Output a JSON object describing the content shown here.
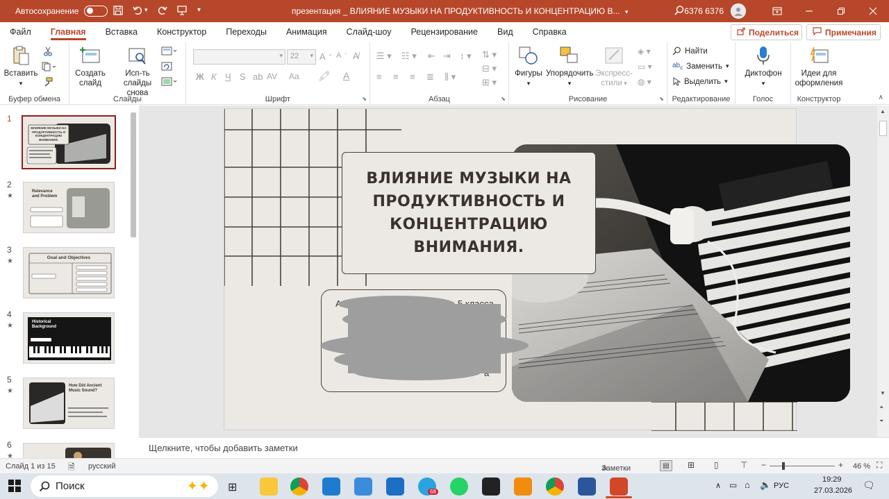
{
  "title_bar": {
    "autosave_label": "Автосохранение",
    "document_title": "презентация _ ВЛИЯНИЕ МУЗЫКИ НА ПРОДУКТИВНОСТЬ И КОНЦЕНТРАЦИЮ В...",
    "user_name": "6376 6376",
    "accent_color": "#b7472a"
  },
  "tabs": [
    "Файл",
    "Главная",
    "Вставка",
    "Конструктор",
    "Переходы",
    "Анимация",
    "Слайд-шоу",
    "Рецензирование",
    "Вид",
    "Справка"
  ],
  "tabs_active": "Главная",
  "share_label": "Поделиться",
  "comments_label": "Примечания",
  "ribbon": {
    "clipboard": {
      "paste": "Вставить",
      "group": "Буфер обмена"
    },
    "slides": {
      "new_slide": "Создать слайд",
      "reuse": "Исп-ть слайды снова",
      "group": "Слайды"
    },
    "font": {
      "size": "22",
      "group": "Шрифт",
      "bold": "Ж",
      "italic": "К",
      "underline": "Ч",
      "strike": "S",
      "spacing": "AV",
      "case": "Aa"
    },
    "paragraph": {
      "group": "Абзац"
    },
    "drawing": {
      "shapes": "Фигуры",
      "arrange": "Упорядочить",
      "quick_styles_1": "Экспресс-",
      "quick_styles_2": "стили",
      "group": "Рисование"
    },
    "editing": {
      "find": "Найти",
      "replace": "Заменить",
      "select": "Выделить",
      "group": "Редактирование"
    },
    "voice": {
      "dictate": "Диктофон",
      "group": "Голос"
    },
    "designer": {
      "ideas_1": "Идеи для",
      "ideas_2": "оформления",
      "group": "Конструктор"
    }
  },
  "thumbnails": [
    {
      "num": "1",
      "title": "ВЛИЯНИЕ МУЗЫКИ НА ПРОДУКТИВНОСТЬ И КОНЦЕНТРАЦИЮ ВНИМАНИЯ.",
      "star": ""
    },
    {
      "num": "2",
      "title": "Relevance and Problem",
      "star": "★"
    },
    {
      "num": "3",
      "title": "Goal and Objectives",
      "star": "★"
    },
    {
      "num": "4",
      "title": "Historical Background",
      "star": "★"
    },
    {
      "num": "5",
      "title": "How Did Ancient Music Sound?",
      "star": "★"
    },
    {
      "num": "6",
      "title": "",
      "star": "★"
    }
  ],
  "slide": {
    "title": "ВЛИЯНИЕ МУЗЫКИ НА ПРОДУКТИВНОСТЬ И КОНЦЕНТРАЦИЮ ВНИМАНИЯ.",
    "subtitle_visible_start": "А",
    "subtitle_visible_mid": "5 класса",
    "subtitle_visible_end": "а"
  },
  "notes_placeholder": "Щелкните, чтобы добавить заметки",
  "status": {
    "slide_info": "Слайд 1 из 15",
    "language": "русский",
    "notes_btn": "Заметки",
    "zoom": "46 %"
  },
  "taskbar": {
    "search_label": "Поиск",
    "lang": "РУС",
    "time": "19:29",
    "date": "27.03.2026",
    "telegram_badge": "68"
  }
}
